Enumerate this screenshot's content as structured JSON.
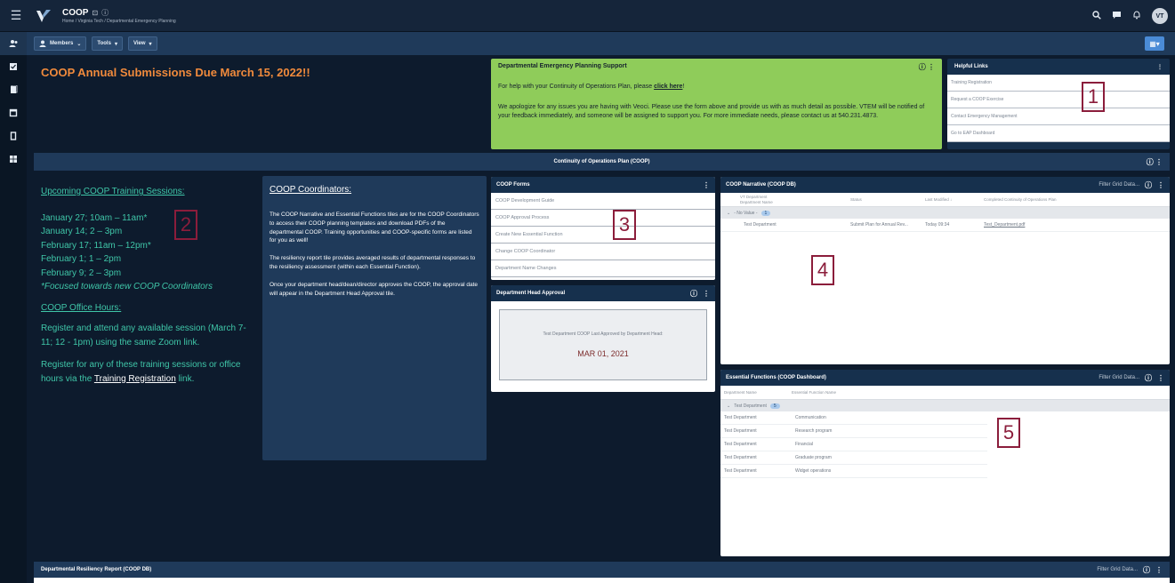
{
  "topbar": {
    "app_title": "COOP",
    "breadcrumb": "Home / Virginia Tech / Departmental Emergency Planning",
    "avatar_initials": "VT"
  },
  "toolbar": {
    "members_label": "Members",
    "tools_label": "Tools",
    "view_label": "View"
  },
  "announcement": "COOP Annual Submissions Due March 15, 2022!!",
  "support": {
    "title": "Departmental Emergency Planning Support",
    "p1_text": "For help with your Continuity of Operations Plan, please",
    "p1_link": "click here",
    "p2": "We apologize for any issues you are having with Veoci. Please use the form above and provide us with as much detail as possible. VTEM will be notified of your feedback immediately, and someone will be assigned to support you. For more immediate needs, please contact us at 540.231.4873."
  },
  "helpful_links": {
    "title": "Helpful Links",
    "items": [
      "Training Registration",
      "Request a COOP Exercise",
      "Contact Emergency Management",
      "Go to EAP Dashboard"
    ]
  },
  "section_title": "Continuity of Operations Plan (COOP)",
  "training": {
    "heading": "Upcoming COOP Training Sessions:",
    "sessions": [
      "January 27; 10am – 11am*",
      "January 14; 2 – 3pm",
      "February 17; 11am – 12pm*",
      "February 1; 1 – 2pm",
      "February 9; 2 – 3pm"
    ],
    "note": "*Focused towards new COOP Coordinators",
    "office_heading": "COOP Office Hours:",
    "office_text": "Register and attend any available session (March 7-11; 12 - 1pm) using the same Zoom link.",
    "register_text_1": "Register for any of these training sessions or office hours via the",
    "register_link": "Training Registration",
    "register_text_2": "link."
  },
  "coordinators": {
    "heading": "COOP Coordinators:",
    "p1": "The COOP Narrative and Essential Functions tiles are for the COOP Coordinators to access their COOP planning templates and download PDFs of the departmental COOP. Training opportunities and COOP-specific forms are listed for you as well!",
    "p2": "The resiliency report tile provides averaged results of departmental responses to the resiliency assessment (within each Essential Function).",
    "p3": "Once your department head/dean/director approves the COOP, the approval date will appear in the Department Head Approval tile."
  },
  "coop_forms": {
    "title": "COOP Forms",
    "items": [
      "COOP Development Guide",
      "COOP Approval Process",
      "Create New Essential Function",
      "Change COOP Coordinator",
      "Department Name Changes"
    ]
  },
  "approval": {
    "title": "Department Head Approval",
    "caption": "Test Department COOP Last Approved by Department Head:",
    "date": "MAR 01, 2021"
  },
  "narrative": {
    "title": "COOP Narrative (COOP DB)",
    "filter_placeholder": "Filter Grid Data...",
    "col_dept_1": "VT Department",
    "col_dept_2": "Department Name",
    "col_status": "Status",
    "col_modified": "Last Modified",
    "col_plan": "Completed Continuity of Operations Plan",
    "group_label": "- No Value -",
    "group_count": "1",
    "row": {
      "dept": "Test Department",
      "status": "Submit Plan for Annual Rev...",
      "modified": "Today 09:34",
      "plan": "Test_Department.pdf"
    }
  },
  "essential": {
    "title": "Essential Functions (COOP Dashboard)",
    "filter_placeholder": "Filter Grid Data...",
    "col_dept": "Department Name",
    "col_func": "Essential Function Name",
    "group_label": "Test Department",
    "group_count": "5",
    "rows": [
      {
        "dept": "Test Department",
        "func": "Communication"
      },
      {
        "dept": "Test Department",
        "func": "Research program"
      },
      {
        "dept": "Test Department",
        "func": "Financial"
      },
      {
        "dept": "Test Department",
        "func": "Graduate program"
      },
      {
        "dept": "Test Department",
        "func": "Widget operations"
      }
    ]
  },
  "resiliency": {
    "title": "Departmental Resiliency Report (COOP DB)",
    "filter_placeholder": "Filter Grid Data..."
  },
  "markers": [
    "1",
    "2",
    "3",
    "4",
    "5"
  ],
  "icons": {
    "hamburger": "hamburger-icon",
    "search": "search-icon",
    "chat": "chat-icon",
    "bell": "bell-icon",
    "info": "info-icon",
    "kebab": "kebab-icon",
    "members": "person-icon",
    "layout": "layout-icon"
  },
  "colors": {
    "background": "#0d1b2d",
    "panel_dark": "#1f3a5a",
    "announcement": "#f08a3c",
    "support_green": "#8fcc5a",
    "training_teal": "#3fc6a8",
    "marker": "#8b1d3b",
    "approval_date": "#7c2c2c"
  }
}
